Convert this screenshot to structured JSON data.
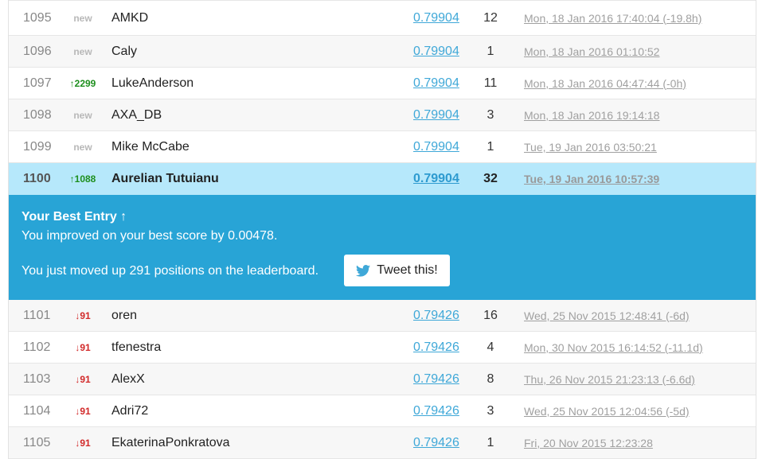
{
  "rows_before": [
    {
      "rank": "1095",
      "change": "new",
      "change_kind": "new",
      "team": "AMKD",
      "score": "0.79904",
      "entries": "12",
      "last": "Mon, 18 Jan 2016 17:40:04 (-19.8h)"
    },
    {
      "rank": "1096",
      "change": "new",
      "change_kind": "new",
      "team": "Caly",
      "score": "0.79904",
      "entries": "1",
      "last": "Mon, 18 Jan 2016 01:10:52"
    },
    {
      "rank": "1097",
      "change": "↑2299",
      "change_kind": "up",
      "team": "LukeAnderson",
      "score": "0.79904",
      "entries": "11",
      "last": "Mon, 18 Jan 2016 04:47:44 (-0h)"
    },
    {
      "rank": "1098",
      "change": "new",
      "change_kind": "new",
      "team": "AXA_DB",
      "score": "0.79904",
      "entries": "3",
      "last": "Mon, 18 Jan 2016 19:14:18"
    },
    {
      "rank": "1099",
      "change": "new",
      "change_kind": "new",
      "team": "Mike McCabe",
      "score": "0.79904",
      "entries": "1",
      "last": "Tue, 19 Jan 2016 03:50:21"
    },
    {
      "rank": "1100",
      "change": "↑1088",
      "change_kind": "up",
      "team": "Aurelian Tutuianu",
      "score": "0.79904",
      "entries": "32",
      "last": "Tue, 19 Jan 2016 10:57:39"
    }
  ],
  "best_entry": {
    "title": "Your Best Entry ↑",
    "improved_text": "You improved on your best score by 0.00478.",
    "moved_text": "You just moved up 291 positions on the leaderboard.",
    "tweet_label": "Tweet this!",
    "tweet_icon": "twitter-bird-icon"
  },
  "rows_after": [
    {
      "rank": "1101",
      "change": "↓91",
      "change_kind": "down",
      "team": "oren",
      "score": "0.79426",
      "entries": "16",
      "last": "Wed, 25 Nov 2015 12:48:41 (-6d)"
    },
    {
      "rank": "1102",
      "change": "↓91",
      "change_kind": "down",
      "team": "tfenestra",
      "score": "0.79426",
      "entries": "4",
      "last": "Mon, 30 Nov 2015 16:14:52 (-11.1d)"
    },
    {
      "rank": "1103",
      "change": "↓91",
      "change_kind": "down",
      "team": "AlexX",
      "score": "0.79426",
      "entries": "8",
      "last": "Thu, 26 Nov 2015 21:23:13 (-6.6d)"
    },
    {
      "rank": "1104",
      "change": "↓91",
      "change_kind": "down",
      "team": "Adri72",
      "score": "0.79426",
      "entries": "3",
      "last": "Wed, 25 Nov 2015 12:04:56 (-5d)"
    },
    {
      "rank": "1105",
      "change": "↓91",
      "change_kind": "down",
      "team": "EkaterinaPonkratova",
      "score": "0.79426",
      "entries": "1",
      "last": "Fri, 20 Nov 2015 12:23:28"
    }
  ],
  "colors": {
    "highlight_row": "#b6e8fb",
    "best_entry_bg": "#28a4d6",
    "up": "#1e8f1e",
    "down": "#d22a2a",
    "new": "#b8b8b8",
    "score_link": "#3fa8d8"
  }
}
